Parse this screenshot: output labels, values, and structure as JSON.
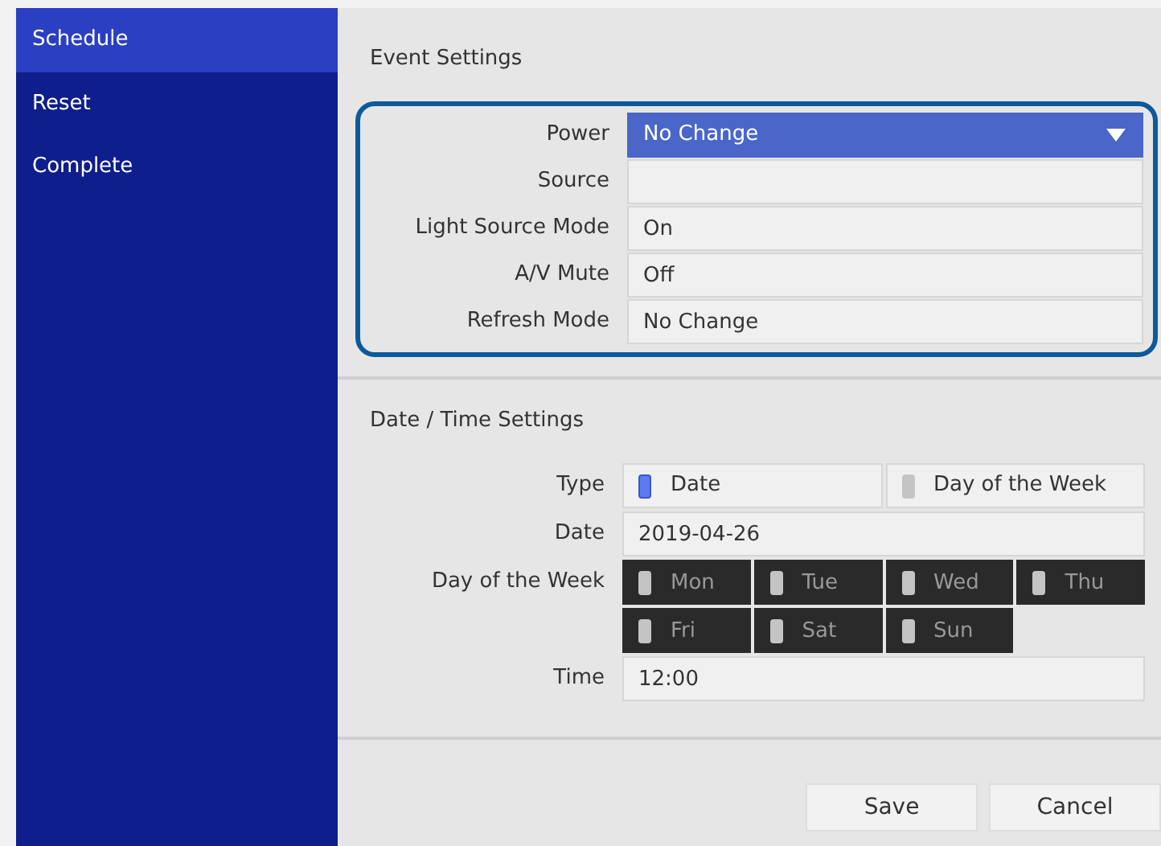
{
  "sidebar": {
    "items": [
      {
        "label": "Schedule",
        "selected": true
      },
      {
        "label": "Reset",
        "selected": false
      },
      {
        "label": "Complete",
        "selected": false
      }
    ]
  },
  "event_settings": {
    "title": "Event Settings",
    "highlighted": true,
    "rows": [
      {
        "label": "Power",
        "value": "No Change",
        "kind": "dropdown",
        "focused": true
      },
      {
        "label": "Source",
        "value": "",
        "kind": "field",
        "focused": false
      },
      {
        "label": "Light Source Mode",
        "value": "On",
        "kind": "field",
        "focused": false
      },
      {
        "label": "A/V Mute",
        "value": "Off",
        "kind": "field",
        "focused": false
      },
      {
        "label": "Refresh Mode",
        "value": "No Change",
        "kind": "field",
        "focused": false
      }
    ]
  },
  "date_time_settings": {
    "title": "Date / Time Settings",
    "type": {
      "label": "Type",
      "options": [
        {
          "label": "Date",
          "selected": true
        },
        {
          "label": "Day of the Week",
          "selected": false
        }
      ]
    },
    "date": {
      "label": "Date",
      "value": "2019-04-26"
    },
    "day_of_week": {
      "label": "Day of the Week",
      "disabled": true,
      "days": [
        {
          "label": "Mon",
          "checked": false
        },
        {
          "label": "Tue",
          "checked": false
        },
        {
          "label": "Wed",
          "checked": false
        },
        {
          "label": "Thu",
          "checked": false
        },
        {
          "label": "Fri",
          "checked": false
        },
        {
          "label": "Sat",
          "checked": false
        },
        {
          "label": "Sun",
          "checked": false
        }
      ]
    },
    "time": {
      "label": "Time",
      "value": "12:00"
    }
  },
  "buttons": [
    "Save",
    "Cancel"
  ]
}
